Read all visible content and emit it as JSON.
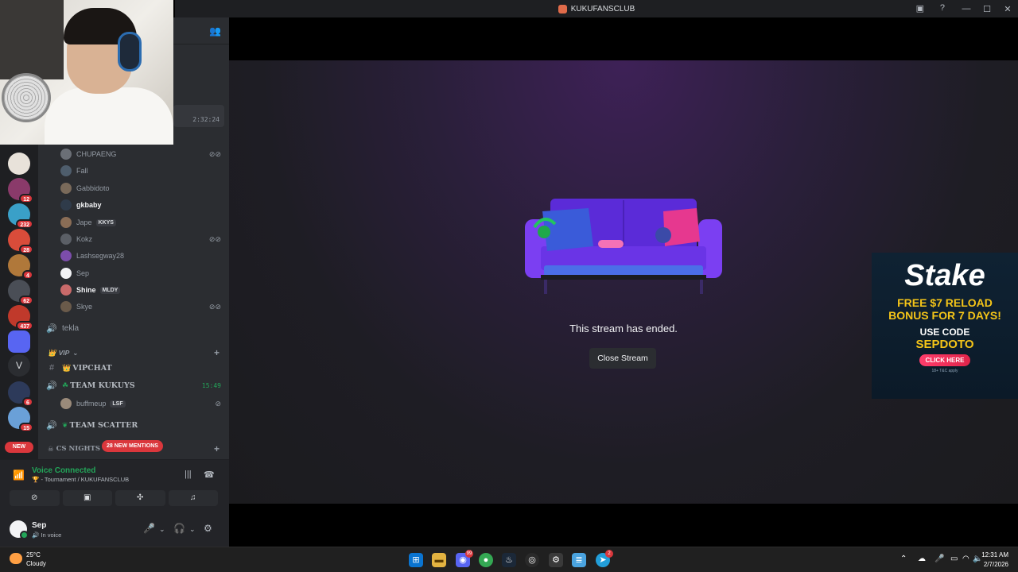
{
  "window": {
    "title": "KUKUFANSCLUB"
  },
  "sidebar": {
    "servers": [
      {
        "badge": ""
      },
      {
        "badge": "12"
      },
      {
        "badge": "232"
      },
      {
        "badge": "28"
      },
      {
        "badge": "4"
      },
      {
        "badge": "62"
      },
      {
        "badge": "437"
      },
      {
        "badge": ""
      },
      {
        "letter": "V"
      },
      {
        "badge": "6"
      },
      {
        "badge": "15"
      }
    ],
    "new_label": "NEW"
  },
  "stream_timer": "2:32:24",
  "members_top": [
    {
      "name": "CHUPAENG",
      "bold": false,
      "tag": "",
      "muted": true
    },
    {
      "name": "Fall",
      "bold": false,
      "tag": "",
      "muted": false
    },
    {
      "name": "Gabbidoto",
      "bold": false,
      "tag": "",
      "muted": false
    },
    {
      "name": "gkbaby",
      "bold": true,
      "tag": "",
      "muted": false
    },
    {
      "name": "Jape",
      "bold": false,
      "tag": "KKYS",
      "muted": false
    },
    {
      "name": "Kokz",
      "bold": false,
      "tag": "",
      "muted": true
    },
    {
      "name": "Lashsegway28",
      "bold": false,
      "tag": "",
      "muted": false
    },
    {
      "name": "Sep",
      "bold": false,
      "tag": "",
      "muted": false
    },
    {
      "name": "Shine",
      "bold": true,
      "tag": "MLDY",
      "muted": false
    },
    {
      "name": "Skye",
      "bold": false,
      "tag": "",
      "muted": true
    }
  ],
  "channels": {
    "tekla": "tekla",
    "vip_category": "VIP",
    "vipchat": "VIPCHAT",
    "team_kukuys": "TEAM KUKUYS",
    "team_kukuys_time": "15:49",
    "buffmeup": {
      "name": "buffmeup",
      "tag": "LSF"
    },
    "team_scatter": "TEAM SCATTER",
    "cs_nights": "CS NIGHTS",
    "new_mentions": "28 NEW MENTIONS"
  },
  "voice": {
    "status": "Voice Connected",
    "location": "- Tournament / KUKUFANSCLUB"
  },
  "user": {
    "name": "Sep",
    "status": "In voice"
  },
  "stream": {
    "ended_text": "This stream has ended.",
    "close_button": "Close Stream"
  },
  "ad": {
    "brand": "Stake",
    "headline_line1": "FREE $7 RELOAD",
    "headline_line2": "BONUS FOR 7 DAYS!",
    "code_label": "USE CODE",
    "code": "SEPDOTO",
    "cta": "CLICK HERE",
    "fine_print": "18+ T&C apply"
  },
  "taskbar": {
    "weather_temp": "25°C",
    "weather_desc": "Cloudy",
    "discord_badge": "99",
    "telegram_badge": "2",
    "time": "12:31 AM",
    "date": "2/7/2026"
  },
  "colors": {
    "discord_bg": "#2b2d31",
    "rail_bg": "#1e1f22",
    "green": "#23a559",
    "red": "#da373c",
    "stake_yellow": "#f5c518"
  }
}
